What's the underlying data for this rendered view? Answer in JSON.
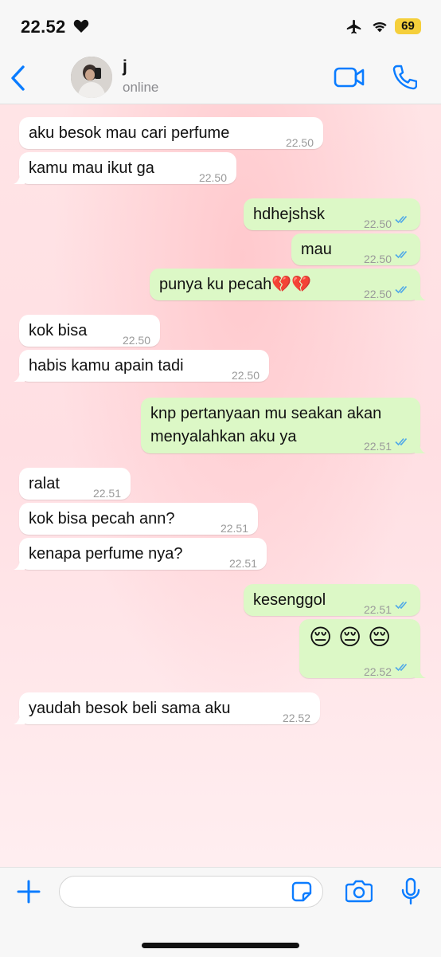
{
  "status_bar": {
    "time": "22.52",
    "battery": "69"
  },
  "header": {
    "name": "j",
    "status": "online"
  },
  "messages": [
    {
      "dir": "in",
      "text": "aku besok mau cari perfume",
      "time": "22.50"
    },
    {
      "dir": "in",
      "text": "kamu mau ikut ga",
      "time": "22.50"
    },
    {
      "dir": "out",
      "text": "hdhejshsk",
      "time": "22.50",
      "read": true
    },
    {
      "dir": "out",
      "text": "mau",
      "time": "22.50",
      "read": true
    },
    {
      "dir": "out",
      "text": "punya ku pecah💔💔",
      "time": "22.50",
      "read": true
    },
    {
      "dir": "in",
      "text": "kok bisa",
      "time": "22.50"
    },
    {
      "dir": "in",
      "text": "habis kamu apain tadi",
      "time": "22.50"
    },
    {
      "dir": "out",
      "text_line1": "knp pertanyaan mu seakan akan",
      "text_line2": "menyalahkan aku ya",
      "time": "22.51",
      "read": true
    },
    {
      "dir": "in",
      "text": "ralat",
      "time": "22.51"
    },
    {
      "dir": "in",
      "text": "kok bisa pecah ann?",
      "time": "22.51"
    },
    {
      "dir": "in",
      "text": "kenapa perfume nya?",
      "time": "22.51"
    },
    {
      "dir": "out",
      "text": "kesenggol",
      "time": "22.51",
      "read": true
    },
    {
      "dir": "out",
      "text": "😔 😔 😔",
      "time": "22.52",
      "read": true
    },
    {
      "dir": "in",
      "text": "yaudah besok beli sama aku",
      "time": "22.52"
    }
  ],
  "input": {
    "placeholder": ""
  },
  "colors": {
    "accent": "#0a7cff",
    "outgoing_bubble": "#dcf8c6",
    "incoming_bubble": "#ffffff",
    "read_ticks": "#4fa8e8",
    "battery": "#f5cf3b"
  },
  "icons": [
    "heart-icon",
    "airplane-icon",
    "wifi-icon",
    "back-icon",
    "video-call-icon",
    "phone-call-icon",
    "plus-icon",
    "sticker-icon",
    "camera-icon",
    "microphone-icon",
    "double-check-icon"
  ]
}
